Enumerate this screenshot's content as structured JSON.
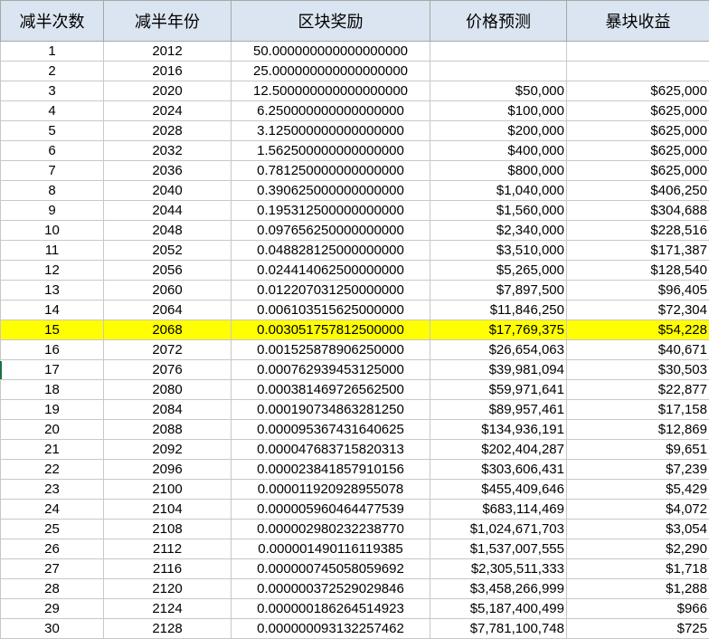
{
  "columns": {
    "halving_count": "减半次数",
    "halving_year": "减半年份",
    "block_reward": "区块奖励",
    "price_forecast": "价格预测",
    "windfall_profit": "暴块收益"
  },
  "highlight_color": "#ffff00",
  "header_color": "#dbe5f1",
  "rows": [
    {
      "n": "1",
      "year": "2012",
      "reward": "50.000000000000000000",
      "price": "",
      "profit": ""
    },
    {
      "n": "2",
      "year": "2016",
      "reward": "25.000000000000000000",
      "price": "",
      "profit": ""
    },
    {
      "n": "3",
      "year": "2020",
      "reward": "12.500000000000000000",
      "price": "$50,000",
      "profit": "$625,000"
    },
    {
      "n": "4",
      "year": "2024",
      "reward": "6.250000000000000000",
      "price": "$100,000",
      "profit": "$625,000"
    },
    {
      "n": "5",
      "year": "2028",
      "reward": "3.125000000000000000",
      "price": "$200,000",
      "profit": "$625,000"
    },
    {
      "n": "6",
      "year": "2032",
      "reward": "1.562500000000000000",
      "price": "$400,000",
      "profit": "$625,000"
    },
    {
      "n": "7",
      "year": "2036",
      "reward": "0.781250000000000000",
      "price": "$800,000",
      "profit": "$625,000"
    },
    {
      "n": "8",
      "year": "2040",
      "reward": "0.390625000000000000",
      "price": "$1,040,000",
      "profit": "$406,250"
    },
    {
      "n": "9",
      "year": "2044",
      "reward": "0.195312500000000000",
      "price": "$1,560,000",
      "profit": "$304,688"
    },
    {
      "n": "10",
      "year": "2048",
      "reward": "0.097656250000000000",
      "price": "$2,340,000",
      "profit": "$228,516"
    },
    {
      "n": "11",
      "year": "2052",
      "reward": "0.048828125000000000",
      "price": "$3,510,000",
      "profit": "$171,387"
    },
    {
      "n": "12",
      "year": "2056",
      "reward": "0.024414062500000000",
      "price": "$5,265,000",
      "profit": "$128,540"
    },
    {
      "n": "13",
      "year": "2060",
      "reward": "0.012207031250000000",
      "price": "$7,897,500",
      "profit": "$96,405"
    },
    {
      "n": "14",
      "year": "2064",
      "reward": "0.006103515625000000",
      "price": "$11,846,250",
      "profit": "$72,304"
    },
    {
      "n": "15",
      "year": "2068",
      "reward": "0.003051757812500000",
      "price": "$17,769,375",
      "profit": "$54,228",
      "highlight": true
    },
    {
      "n": "16",
      "year": "2072",
      "reward": "0.001525878906250000",
      "price": "$26,654,063",
      "profit": "$40,671"
    },
    {
      "n": "17",
      "year": "2076",
      "reward": "0.000762939453125000",
      "price": "$39,981,094",
      "profit": "$30,503"
    },
    {
      "n": "18",
      "year": "2080",
      "reward": "0.000381469726562500",
      "price": "$59,971,641",
      "profit": "$22,877"
    },
    {
      "n": "19",
      "year": "2084",
      "reward": "0.000190734863281250",
      "price": "$89,957,461",
      "profit": "$17,158"
    },
    {
      "n": "20",
      "year": "2088",
      "reward": "0.000095367431640625",
      "price": "$134,936,191",
      "profit": "$12,869"
    },
    {
      "n": "21",
      "year": "2092",
      "reward": "0.000047683715820313",
      "price": "$202,404,287",
      "profit": "$9,651"
    },
    {
      "n": "22",
      "year": "2096",
      "reward": "0.000023841857910156",
      "price": "$303,606,431",
      "profit": "$7,239"
    },
    {
      "n": "23",
      "year": "2100",
      "reward": "0.000011920928955078",
      "price": "$455,409,646",
      "profit": "$5,429"
    },
    {
      "n": "24",
      "year": "2104",
      "reward": "0.000005960464477539",
      "price": "$683,114,469",
      "profit": "$4,072"
    },
    {
      "n": "25",
      "year": "2108",
      "reward": "0.000002980232238770",
      "price": "$1,024,671,703",
      "profit": "$3,054"
    },
    {
      "n": "26",
      "year": "2112",
      "reward": "0.000001490116119385",
      "price": "$1,537,007,555",
      "profit": "$2,290"
    },
    {
      "n": "27",
      "year": "2116",
      "reward": "0.000000745058059692",
      "price": "$2,305,511,333",
      "profit": "$1,718"
    },
    {
      "n": "28",
      "year": "2120",
      "reward": "0.000000372529029846",
      "price": "$3,458,266,999",
      "profit": "$1,288"
    },
    {
      "n": "29",
      "year": "2124",
      "reward": "0.000000186264514923",
      "price": "$5,187,400,499",
      "profit": "$966"
    },
    {
      "n": "30",
      "year": "2128",
      "reward": "0.000000093132257462",
      "price": "$7,781,100,748",
      "profit": "$725"
    }
  ]
}
